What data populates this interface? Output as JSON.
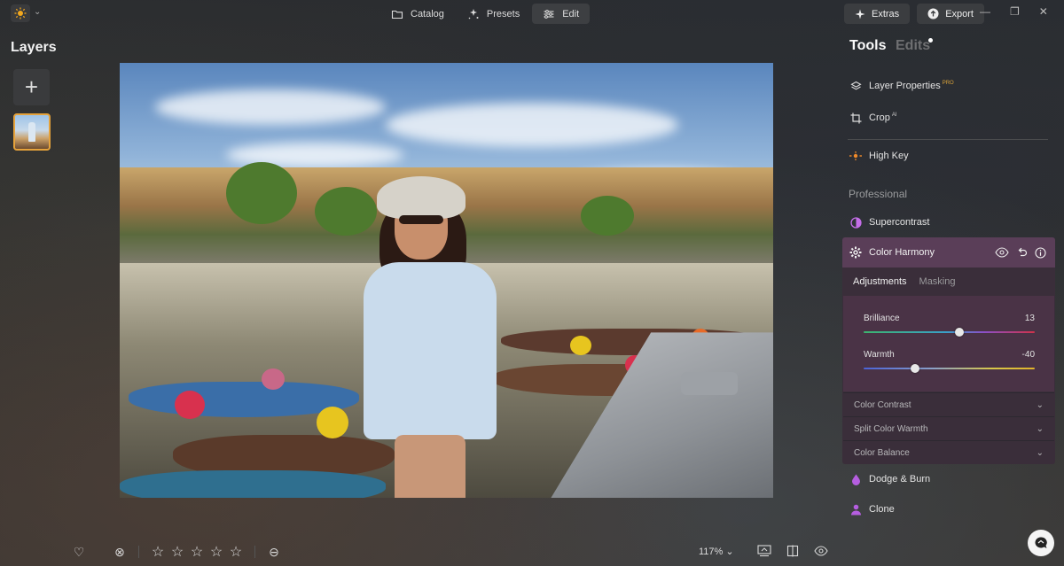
{
  "topbar": {
    "nav": [
      {
        "label": "Catalog",
        "icon": "folder-icon"
      },
      {
        "label": "Presets",
        "icon": "sparkle-icon"
      },
      {
        "label": "Edit",
        "icon": "sliders-icon",
        "active": true
      }
    ],
    "extras_label": "Extras",
    "export_label": "Export"
  },
  "layers": {
    "title": "Layers"
  },
  "bottombar": {
    "zoom": "117%",
    "rating_stars": 5,
    "rating_value": 0
  },
  "panel": {
    "tab_tools": "Tools",
    "tab_edits": "Edits",
    "tools": [
      {
        "label": "Layer Properties",
        "badge": "PRO",
        "icon": "layers-icon"
      },
      {
        "label": "Crop",
        "badge": "AI",
        "icon": "crop-icon"
      },
      {
        "label": "High Key",
        "badge": "",
        "icon": "high-key-icon"
      }
    ],
    "section_professional": "Professional",
    "supercontrast": "Supercontrast",
    "color_harmony": {
      "title": "Color Harmony",
      "subtabs": [
        "Adjustments",
        "Masking"
      ],
      "sliders": [
        {
          "label": "Brilliance",
          "value": "13",
          "fraction": 0.56
        },
        {
          "label": "Warmth",
          "value": "-40",
          "fraction": 0.3
        }
      ],
      "subsections": [
        "Color Contrast",
        "Split Color Warmth",
        "Color Balance"
      ]
    },
    "dodge_burn": "Dodge & Burn",
    "clone": "Clone"
  },
  "colors": {
    "accent_orange": "#e5a23b",
    "color_harmony_header": "#5a3e58",
    "purple_icon": "#b55ee0"
  }
}
